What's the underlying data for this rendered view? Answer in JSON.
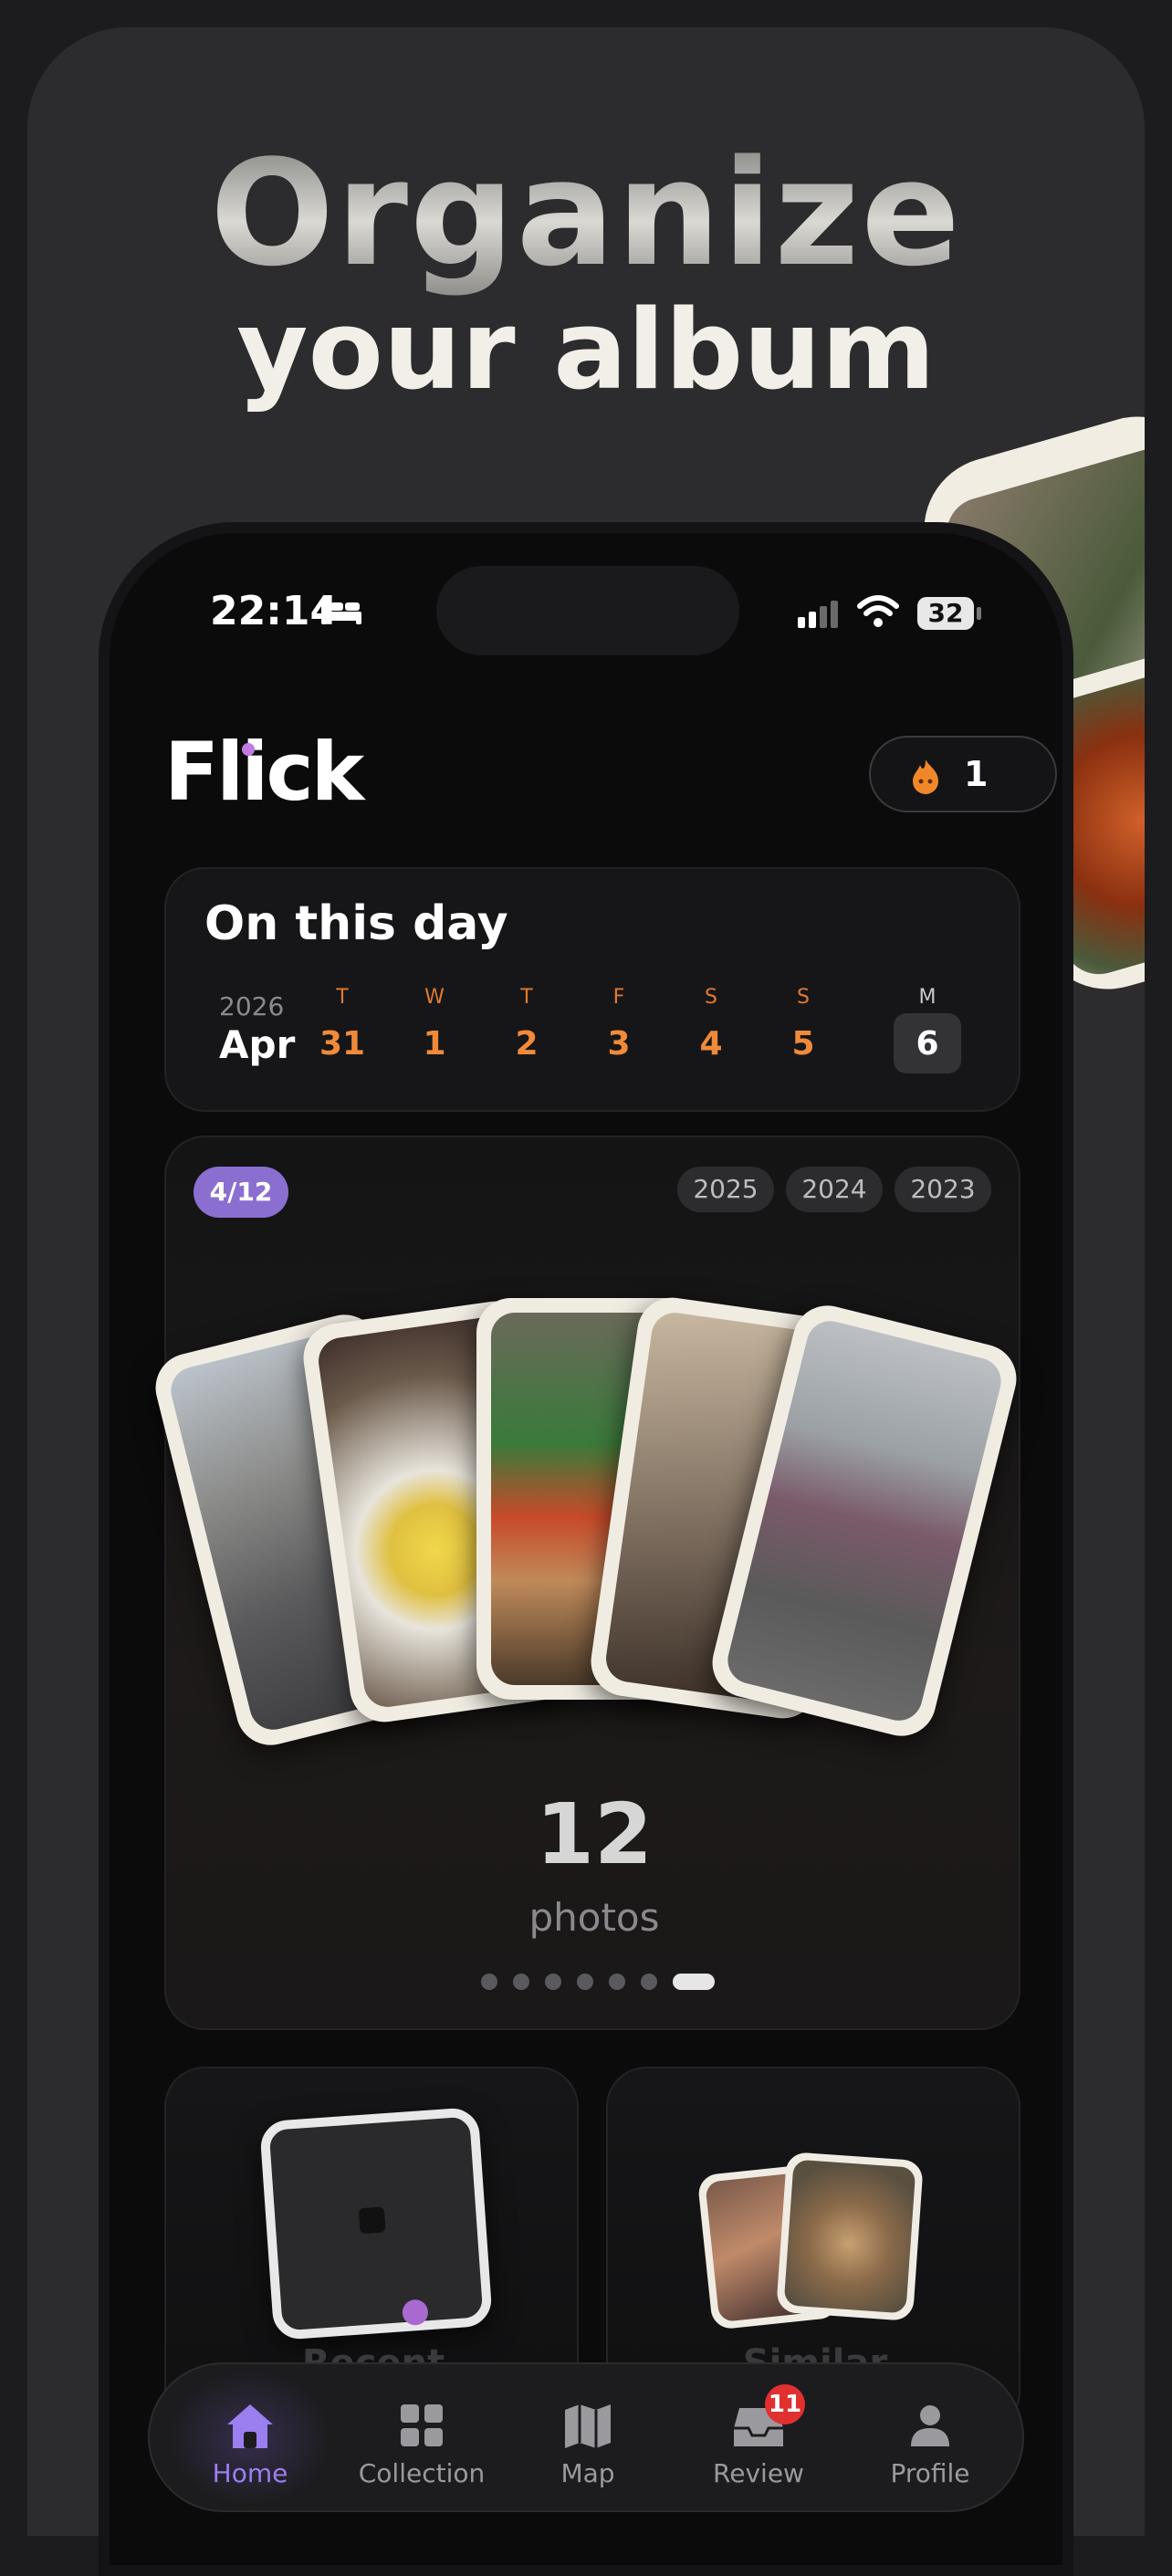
{
  "headline": {
    "line1": "Organize",
    "line2": "your album"
  },
  "status_bar": {
    "time": "22:14",
    "battery": "32",
    "bed_icon": "bed-icon",
    "signal_icon": "cellular-signal-icon",
    "wifi_icon": "wifi-icon"
  },
  "app": {
    "logo": "Flick",
    "streak_count": "1",
    "streak_icon": "flame-icon"
  },
  "on_this_day": {
    "title": "On this day",
    "year": "2026",
    "month": "Apr",
    "days": [
      {
        "weekday": "T",
        "date": "31"
      },
      {
        "weekday": "W",
        "date": "1"
      },
      {
        "weekday": "T",
        "date": "2"
      },
      {
        "weekday": "F",
        "date": "3"
      },
      {
        "weekday": "S",
        "date": "4"
      },
      {
        "weekday": "S",
        "date": "5"
      },
      {
        "weekday": "M",
        "date": "6",
        "selected": true
      }
    ]
  },
  "memory": {
    "progress_badge": "4/12",
    "years": [
      "2025",
      "2024",
      "2023"
    ],
    "photo_count": "12",
    "photo_label": "photos",
    "pager": {
      "total": 7,
      "active": 7
    }
  },
  "tiles": [
    {
      "label": "Recent"
    },
    {
      "label": "Similar"
    }
  ],
  "nav": {
    "items": [
      {
        "label": "Home",
        "icon": "home-icon",
        "active": true
      },
      {
        "label": "Collection",
        "icon": "grid-icon"
      },
      {
        "label": "Map",
        "icon": "map-icon"
      },
      {
        "label": "Review",
        "icon": "inbox-icon",
        "badge": "11"
      },
      {
        "label": "Profile",
        "icon": "person-icon"
      }
    ]
  },
  "colors": {
    "accent": "#9b7ef0",
    "badge_purple": "#8a6fd0",
    "weekday_orange": "#f08a3a",
    "notification_red": "#e03030"
  }
}
